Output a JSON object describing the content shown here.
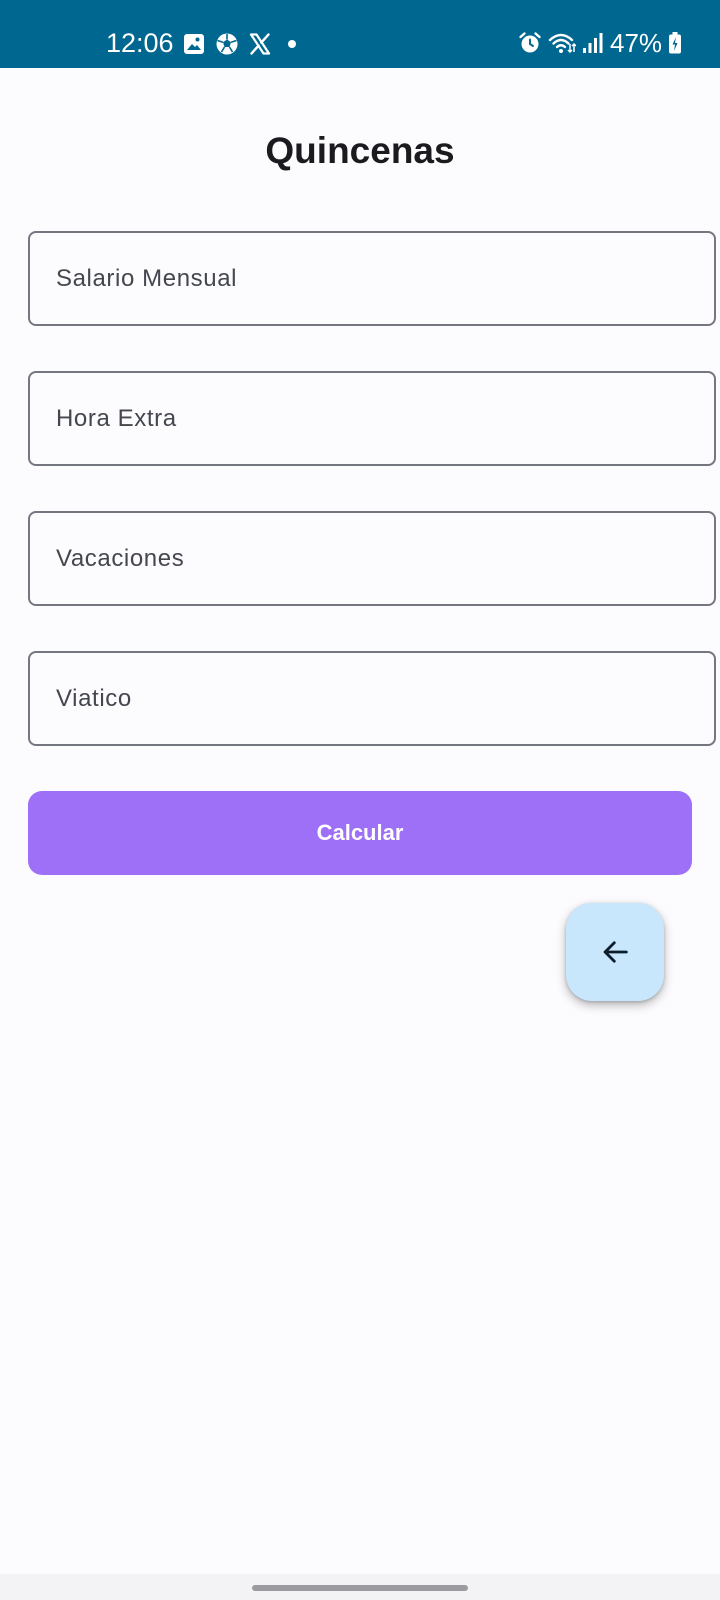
{
  "status_bar": {
    "time": "12:06",
    "battery_percent": "47%",
    "notification_icons": [
      "gallery-icon",
      "soccer-ball-icon",
      "x-logo-icon",
      "dot-icon"
    ],
    "system_icons": [
      "alarm-icon",
      "wifi-icon",
      "signal-icon",
      "battery-charging-icon"
    ],
    "background_color": "#006890"
  },
  "screen": {
    "title": "Quincenas"
  },
  "form": {
    "fields": [
      {
        "label": "Salario Mensual"
      },
      {
        "label": "Hora Extra"
      },
      {
        "label": "Vacaciones"
      },
      {
        "label": "Viatico"
      }
    ],
    "submit_label": "Calcular",
    "submit_color": "#9e6ff7"
  },
  "fab": {
    "icon": "arrow-back-icon",
    "color": "#c8e7fd"
  }
}
